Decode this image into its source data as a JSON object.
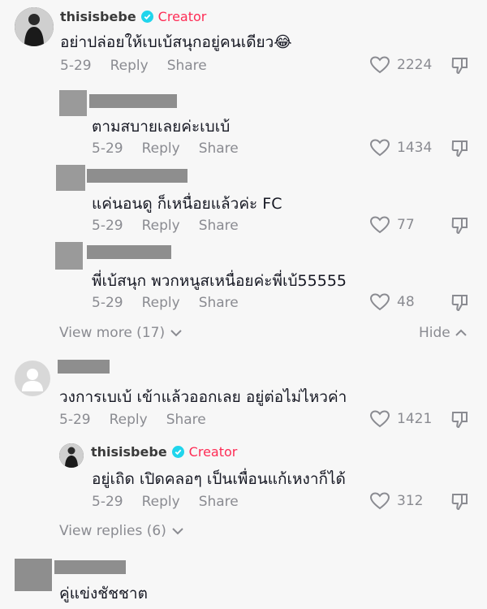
{
  "labels": {
    "reply": "Reply",
    "share": "Share",
    "creator": "Creator"
  },
  "colors": {
    "creator": "#fe2c55",
    "verified": "#20d5ec",
    "meta": "#8a8b91"
  },
  "top_comment": {
    "username": "thisisbebe",
    "text": "อย่าปล่อยให้เบเบ้สนุกอยู่คนเดียว😂",
    "date": "5-29",
    "likes": "2224",
    "replies": [
      {
        "text": "ตามสบายเลยค่ะเบเบ้",
        "date": "5-29",
        "likes": "1434"
      },
      {
        "text": "แค่นอนดู ก็เหนื่อยแล้วค่ะ FC",
        "date": "5-29",
        "likes": "77"
      },
      {
        "text": "พี่เบ้สนุก พวกหนูสเหนื่อยค่ะพี่เบ้55555",
        "date": "5-29",
        "likes": "48"
      }
    ],
    "view_more": "View more (17)",
    "hide": "Hide"
  },
  "second_comment": {
    "text": "วงการเบเบ้ เข้าแล้วออกเลย อยู่ต่อไม่ไหวค่า",
    "date": "5-29",
    "likes": "1421",
    "reply": {
      "username": "thisisbebe",
      "text": "อยู่เถิด เปิดคลอๆ เป็นเพื่อนแก้เหงาก็ได้",
      "date": "5-29",
      "likes": "312"
    },
    "view_replies": "View replies (6)"
  },
  "third_comment": {
    "text": "คู่แข่งชัชชาต"
  }
}
